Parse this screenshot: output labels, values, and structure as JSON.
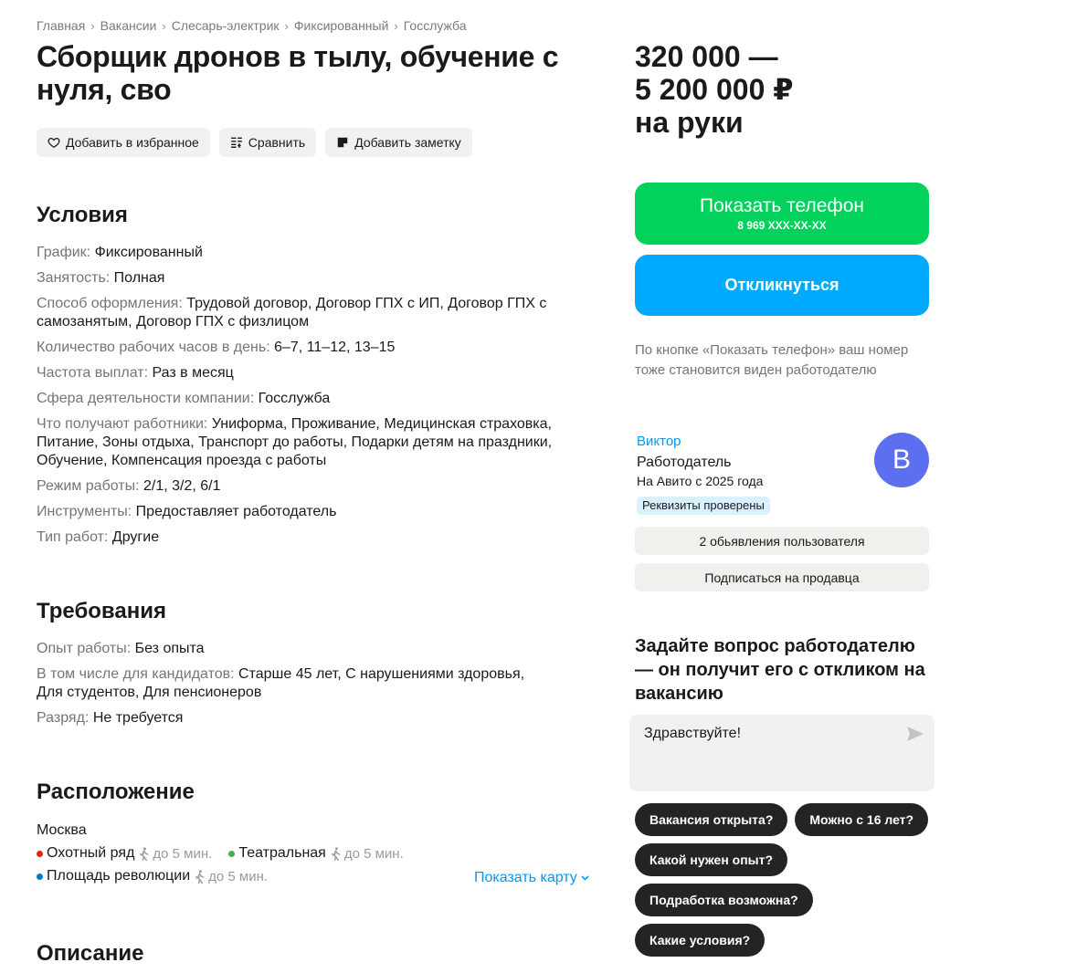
{
  "breadcrumbs": [
    "Главная",
    "Вакансии",
    "Слесарь-электрик",
    "Фиксированный",
    "Госслужба"
  ],
  "breadcrumb_separator": "›",
  "title": "Сборщик дронов в тылу, обучение с нуля, сво",
  "actions": {
    "favorite": "Добавить в избранное",
    "compare": "Сравнить",
    "note": "Добавить заметку"
  },
  "conditions": {
    "title": "Условия",
    "items": [
      {
        "k": "График:",
        "v": "Фиксированный"
      },
      {
        "k": "Занятость:",
        "v": "Полная"
      },
      {
        "k": "Способ оформления:",
        "v": "Трудовой договор, Договор ГПХ с ИП, Договор ГПХ с самозанятым, Договор ГПХ с физлицом"
      },
      {
        "k": "Количество рабочих часов в день:",
        "v": "6–7, 11–12, 13–15"
      },
      {
        "k": "Частота выплат:",
        "v": "Раз в месяц"
      },
      {
        "k": "Сфера деятельности компании:",
        "v": "Госслужба"
      },
      {
        "k": "Что получают работники:",
        "v": "Униформа, Проживание, Медицинская страховка, Питание, Зоны отдыха, Транспорт до работы, Подарки детям на праздники, Обучение, Компенсация проезда с работы"
      },
      {
        "k": "Режим работы:",
        "v": "2/1, 3/2, 6/1"
      },
      {
        "k": "Инструменты:",
        "v": "Предоставляет работодатель"
      },
      {
        "k": "Тип работ:",
        "v": "Другие"
      }
    ]
  },
  "requirements": {
    "title": "Требования",
    "items": [
      {
        "k": "Опыт работы:",
        "v": "Без опыта"
      },
      {
        "k": "В том числе для кандидатов:",
        "v": "Старше 45 лет, С нарушениями здоровья, Для студентов, Для пенсионеров"
      },
      {
        "k": "Разряд:",
        "v": "Не требуется"
      }
    ]
  },
  "location": {
    "title": "Расположение",
    "city": "Москва",
    "metro": [
      {
        "name": "Охотный ряд",
        "time": "до 5 мин.",
        "color": "#e42313"
      },
      {
        "name": "Театральная",
        "time": "до 5 мин.",
        "color": "#4baf4f"
      },
      {
        "name": "Площадь революции",
        "time": "до 5 мин.",
        "color": "#0078c9"
      }
    ],
    "show_map": "Показать карту"
  },
  "description": {
    "title": "Описание"
  },
  "price": {
    "line1": "320 000 —",
    "line2": "5 200 000 ₽",
    "line3": "на руки"
  },
  "phone_button": {
    "label": "Показать телефон",
    "number": "8 969 XXX-XX-XX"
  },
  "respond_button": "Откликнуться",
  "phone_note": "По кнопке «Показать телефон» ваш номер тоже становится виден работодателю",
  "seller": {
    "name": "Виктор",
    "role": "Работодатель",
    "since": "На Авито с 2025 года",
    "verified": "Реквизиты проверены",
    "avatar_letter": "В",
    "ads_button": "2 обьявления пользователя",
    "subscribe_button": "Подписаться на продавца"
  },
  "ask": {
    "title": "Задайте вопрос работодателю — он получит его с откликом на вакансию",
    "input_value": "Здравствуйте!"
  },
  "chips": [
    [
      "Вакансия открыта?",
      "Можно с 16 лет?"
    ],
    [
      "Какой нужен опыт?"
    ],
    [
      "Подработка возможна?"
    ],
    [
      "Какие условия?"
    ]
  ],
  "colors": {
    "green": "#02d15c",
    "blue": "#00aaff",
    "link": "#0099f7",
    "avatar": "#5c6fef"
  }
}
